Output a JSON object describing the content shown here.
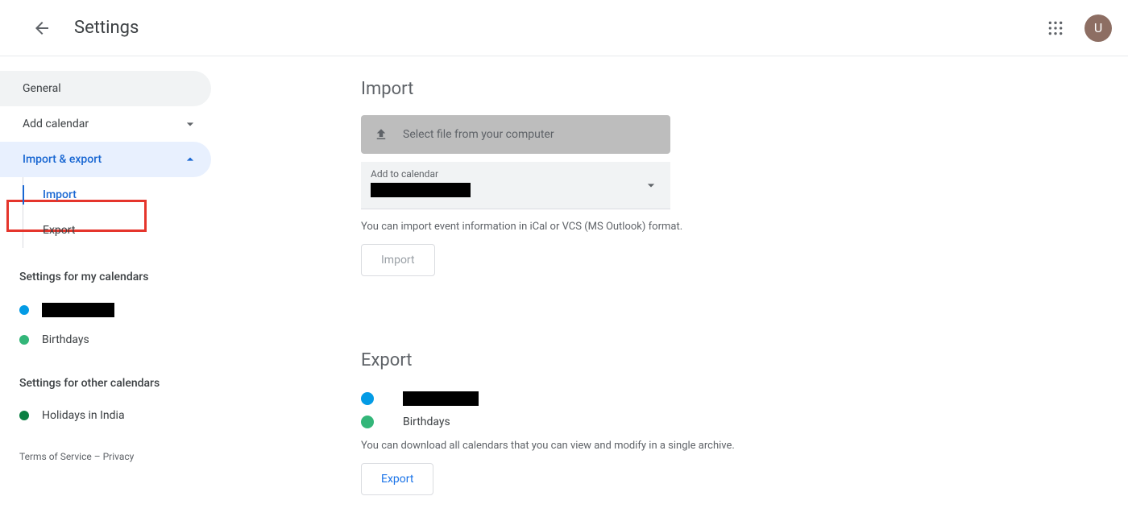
{
  "header": {
    "title": "Settings",
    "avatar_letter": "U"
  },
  "sidebar": {
    "general": "General",
    "add_calendar": "Add calendar",
    "import_export": "Import & export",
    "sub": {
      "import": "Import",
      "export": "Export"
    },
    "my_cal_heading": "Settings for my calendars",
    "my_calendars": [
      {
        "color": "#039be5",
        "label": "",
        "redacted": true
      },
      {
        "color": "#33b679",
        "label": "Birthdays",
        "redacted": false
      }
    ],
    "other_cal_heading": "Settings for other calendars",
    "other_calendars": [
      {
        "color": "#0b8043",
        "label": "Holidays in India",
        "redacted": false
      }
    ],
    "footer": {
      "tos": "Terms of Service",
      "sep": " – ",
      "privacy": "Privacy"
    }
  },
  "main": {
    "import": {
      "title": "Import",
      "file_button": "Select file from your computer",
      "select_label": "Add to calendar",
      "helper": "You can import event information in iCal or VCS (MS Outlook) format.",
      "button": "Import"
    },
    "export": {
      "title": "Export",
      "rows": [
        {
          "color": "#039be5",
          "label": "",
          "redacted": true
        },
        {
          "color": "#33b679",
          "label": "Birthdays",
          "redacted": false
        }
      ],
      "helper": "You can download all calendars that you can view and modify in a single archive.",
      "button": "Export"
    }
  }
}
